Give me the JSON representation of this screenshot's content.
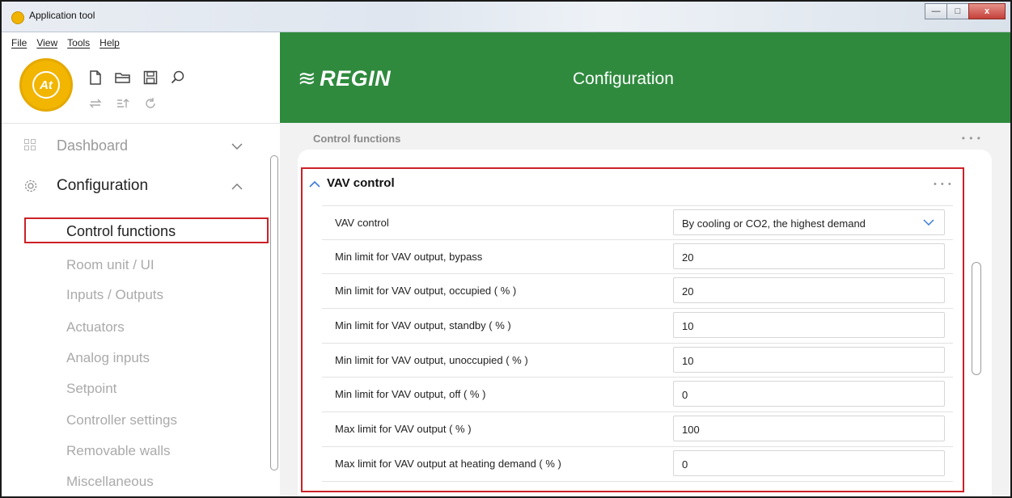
{
  "window": {
    "title": "Application tool",
    "controls": {
      "minimize": "—",
      "maximize": "□",
      "close": "x"
    }
  },
  "menu": [
    "File",
    "View",
    "Tools",
    "Help"
  ],
  "toolbar": {
    "logo_text": "At",
    "row1_icons": [
      "new-file-icon",
      "open-folder-icon",
      "save-icon",
      "search-icon"
    ],
    "row2_icons": [
      "sync-icon",
      "export-icon",
      "refresh-icon"
    ]
  },
  "sidebar": {
    "dashboard": "Dashboard",
    "configuration": "Configuration",
    "items": [
      "Control functions",
      "Room unit / UI",
      "Inputs / Outputs",
      "Actuators",
      "Analog inputs",
      "Setpoint",
      "Controller settings",
      "Removable walls",
      "Miscellaneous"
    ],
    "active_item": "Control functions"
  },
  "header": {
    "brand": "REGIN",
    "title": "Configuration",
    "color": "#2f8a3e"
  },
  "main": {
    "section_title": "Control functions",
    "group": {
      "title": "VAV control",
      "rows": [
        {
          "label": "VAV control",
          "value": "By cooling or CO2, the highest demand",
          "type": "dropdown"
        },
        {
          "label": "Min limit for VAV output, bypass",
          "value": "20",
          "type": "input"
        },
        {
          "label": "Min limit for VAV output, occupied ( % )",
          "value": "20",
          "type": "input"
        },
        {
          "label": "Min limit for VAV output, standby ( % )",
          "value": "10",
          "type": "input"
        },
        {
          "label": "Min limit for VAV output, unoccupied ( % )",
          "value": "10",
          "type": "input"
        },
        {
          "label": "Min limit for VAV output, off ( % )",
          "value": "0",
          "type": "input"
        },
        {
          "label": "Max limit for VAV output ( % )",
          "value": "100",
          "type": "input"
        },
        {
          "label": "Max limit for VAV output at heating demand ( % )",
          "value": "0",
          "type": "input"
        }
      ]
    }
  },
  "colors": {
    "highlight": "#cc2127",
    "accent": "#3d7bd9"
  }
}
